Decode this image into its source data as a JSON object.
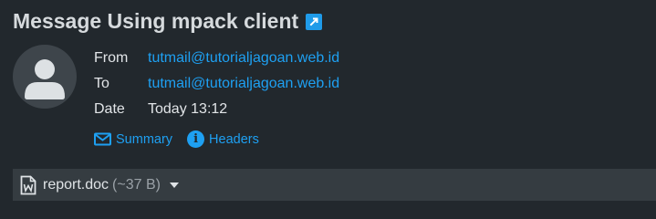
{
  "message": {
    "subject": "Message Using mpack client",
    "popout_icon": "external-link-icon"
  },
  "headers": {
    "from_label": "From",
    "from_value": "tutmail@tutorialjagoan.web.id",
    "to_label": "To",
    "to_value": "tutmail@tutorialjagoan.web.id",
    "date_label": "Date",
    "date_value": "Today 13:12"
  },
  "actions": {
    "summary_label": "Summary",
    "headers_label": "Headers"
  },
  "attachment": {
    "name": "report.doc",
    "size": "(~37 B)",
    "icon": "word-document-icon"
  },
  "colors": {
    "background": "#22282d",
    "accent": "#1ea0f2",
    "attachment_bar": "#353c41"
  }
}
